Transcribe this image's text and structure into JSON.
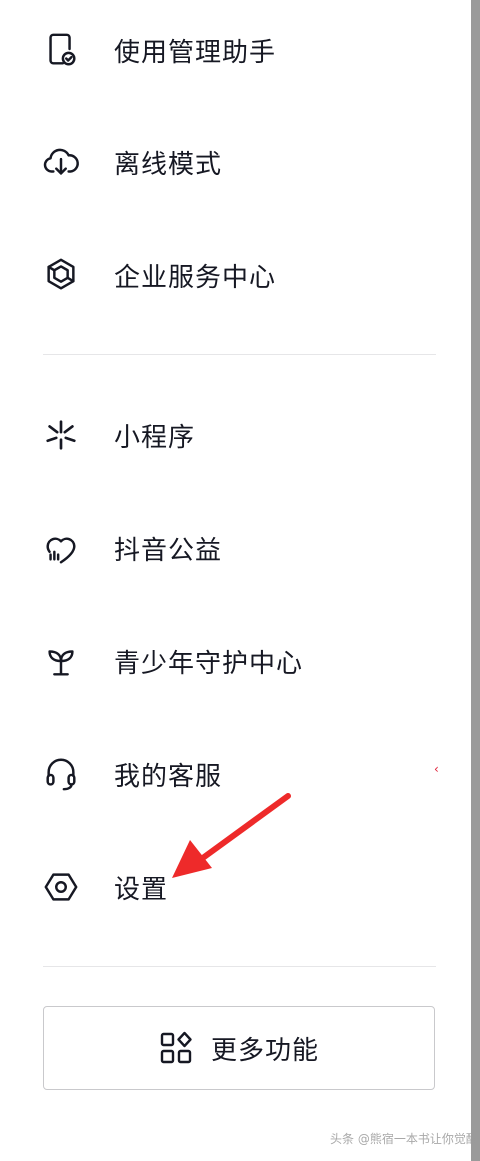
{
  "menu": {
    "items": [
      {
        "label": "使用管理助手",
        "icon": "phone-check-icon"
      },
      {
        "label": "离线模式",
        "icon": "cloud-download-icon"
      },
      {
        "label": "企业服务中心",
        "icon": "enterprise-cube-icon"
      },
      {
        "label": "小程序",
        "icon": "mini-program-icon"
      },
      {
        "label": "抖音公益",
        "icon": "heart-charity-icon"
      },
      {
        "label": "青少年守护中心",
        "icon": "sprout-icon"
      },
      {
        "label": "我的客服",
        "icon": "headset-icon"
      },
      {
        "label": "设置",
        "icon": "hexagon-settings-icon"
      }
    ]
  },
  "more_button": {
    "label": "更多功能",
    "icon": "grid-apps-icon"
  },
  "annotation": {
    "arrow_color": "#ee2a2a"
  },
  "watermark": {
    "text": "头条 @熊宿一本书让你觉醒"
  },
  "colors": {
    "text": "#161823",
    "divider": "#e6e6e8",
    "border": "#c9c9cc"
  }
}
